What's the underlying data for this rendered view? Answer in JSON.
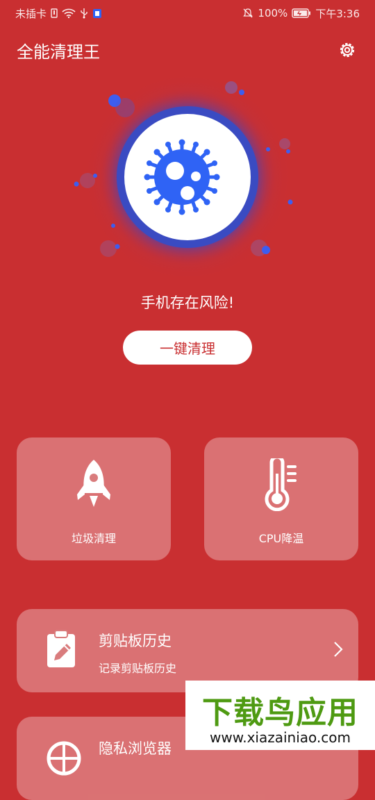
{
  "status_bar": {
    "carrier": "未插卡",
    "battery": "100%",
    "time": "下午3:36",
    "icons": [
      "sim-icon",
      "wifi-icon",
      "usb-icon",
      "notification-icon",
      "mute-icon",
      "battery-icon"
    ]
  },
  "header": {
    "title": "全能清理王",
    "settings_icon": "gear-icon"
  },
  "hero": {
    "icon": "virus-icon",
    "status_text": "手机存在风险!",
    "clean_button": "一键清理"
  },
  "tiles": [
    {
      "label": "垃圾清理",
      "icon": "rocket-icon"
    },
    {
      "label": "CPU降温",
      "icon": "thermometer-icon"
    }
  ],
  "cards": [
    {
      "title": "剪贴板历史",
      "subtitle": "记录剪贴板历史",
      "icon": "clipboard-icon"
    },
    {
      "title": "隐私浏览器",
      "icon": "browser-icon"
    }
  ],
  "watermark": {
    "main": "下载鸟应用",
    "url": "www.xiazainiao.com"
  },
  "colors": {
    "background": "#C92F31",
    "accent_blue": "#2F63F5",
    "tile": "rgba(255,255,255,0.32)",
    "watermark_green": "#4E9A12"
  }
}
